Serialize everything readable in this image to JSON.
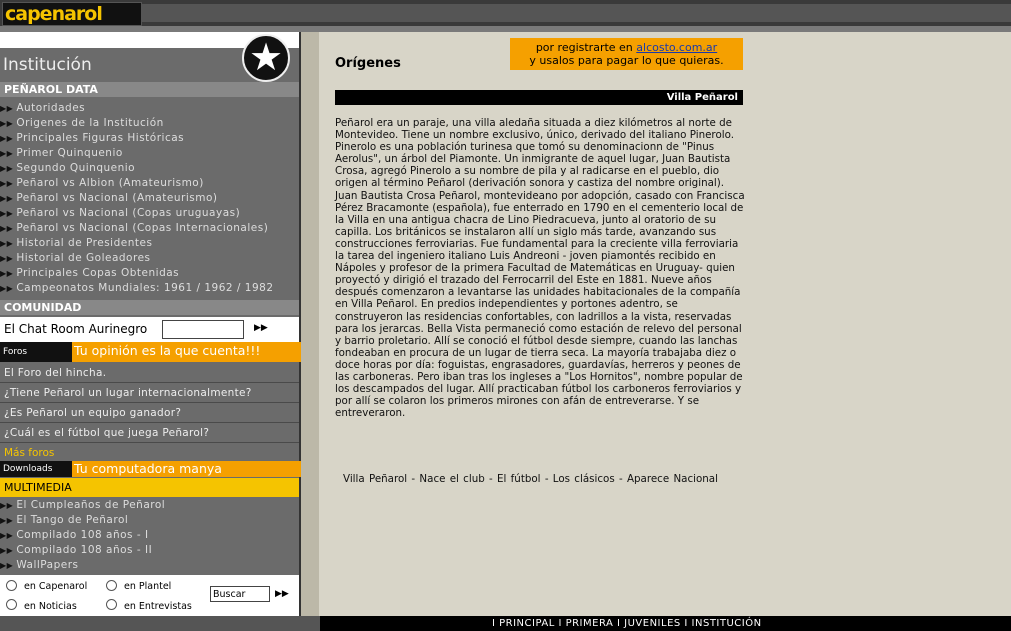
{
  "logo": "capenarol",
  "sidebar": {
    "heading": "Institución",
    "section1": "PEÑAROL DATA",
    "items": [
      "Autoridades",
      "Origenes de la Institución",
      "Principales Figuras Históricas",
      "Primer Quinquenio",
      "Segundo Quinquenio",
      "Peñarol vs Albion (Amateurismo)",
      "Peñarol vs Nacional (Amateurismo)",
      "Peñarol vs Nacional (Copas uruguayas)",
      "Peñarol vs Nacional (Copas Internacionales)",
      "Historial de Presidentes",
      "Historial de Goleadores",
      "Principales Copas Obtenidas",
      "Campeonatos Mundiales: 1961 / 1962 / 1982"
    ],
    "section2": "COMUNIDAD",
    "chat_label": "El Chat Room Aurinegro",
    "foros_label": "Foros",
    "foros_banner": "Tu opinión es la que cuenta!!!",
    "forums": [
      "El Foro del hincha.",
      "¿Tiene Peñarol un lugar internacionalmente?",
      "¿Es Peñarol un equipo ganador?",
      "¿Cuál es el fútbol que juega Peñarol?"
    ],
    "mas_foros": "Más foros",
    "downloads_label": "Downloads",
    "downloads_banner": "Tu computadora manya",
    "section3": "MULTIMEDIA",
    "multimedia": [
      "El Cumpleaños de Peñarol",
      "El Tango de Peñarol",
      "Compilado 108 años - I",
      "Compilado 108 años - II",
      "WallPapers"
    ],
    "search": {
      "opt1": "en Capenarol",
      "opt2": "en Plantel",
      "opt3": "en Noticias",
      "opt4": "en Entrevistas",
      "input_value": "Buscar"
    }
  },
  "main": {
    "title": "Orígenes",
    "ad_line1_prefix": "por registrarte en ",
    "ad_link": "alcosto.com.ar",
    "ad_line2": "y usalos para pagar lo que quieras.",
    "section_bar": "Villa Peñarol",
    "body": "Peñarol era un paraje, una villa aledaña situada a diez kilómetros al norte de Montevideo. Tiene un nombre exclusivo, único, derivado del italiano Pinerolo. Pinerolo es una población turinesa que tomó su denominacionn de \"Pinus Aerolus\", un árbol del Piamonte. Un inmigrante de aquel lugar, Juan Bautista Crosa, agregó Pinerolo a su nombre de pila y al radicarse en el pueblo, dio origen al término Peñarol (derivación sonora y castiza del nombre original). Juan Bautista Crosa Peñarol, montevideano por adopción, casado con Francisca Pérez Bracamonte (española), fue enterrado en 1790 en el cementerio local de la Villa en una antigua chacra de Lino Piedracueva, junto al oratorio de su capilla. Los británicos se instalaron allí un siglo más tarde, avanzando sus construcciones ferroviarias. Fue fundamental para la creciente villa ferroviaria la tarea del ingeniero italiano Luis Andreoni - joven piamontés recibido en Nápoles y profesor de la primera Facultad de Matemáticas en Uruguay- quien proyectó y dirigió el trazado del Ferrocarril del Este en 1881. Nueve años después comenzaron a levantarse las unidades habitacionales de la compañía en Villa Peñarol. En predios independientes y portones adentro, se construyeron las residencias confortables, con ladrillos a la vista, reservadas para los jerarcas. Bella Vista permaneció como estación de relevo del personal y barrio proletario. Allí se conoció el fútbol desde siempre, cuando las lanchas fondeaban en procura de un lugar de tierra seca. La mayoría trabajaba diez o doce horas por día: foguistas, engrasadores, guardavías, herreros y peones de las carboneras. Pero iban tras los ingleses a \"Los Hornitos\", nombre popular de los descampados del lugar. Allí practicaban fútbol los carboneros ferroviarios y por allí se colaron los primeros mirones con afán de entreverarse. Y se entreveraron.",
    "bottom_links": "Villa Peñarol - Nace el club - El fútbol - Los clásicos - Aparece Nacional"
  },
  "footer": {
    "nav": "I PRINCIPAL  I PRIMERA  I JUVENILES  I INSTITUCIÓN"
  }
}
